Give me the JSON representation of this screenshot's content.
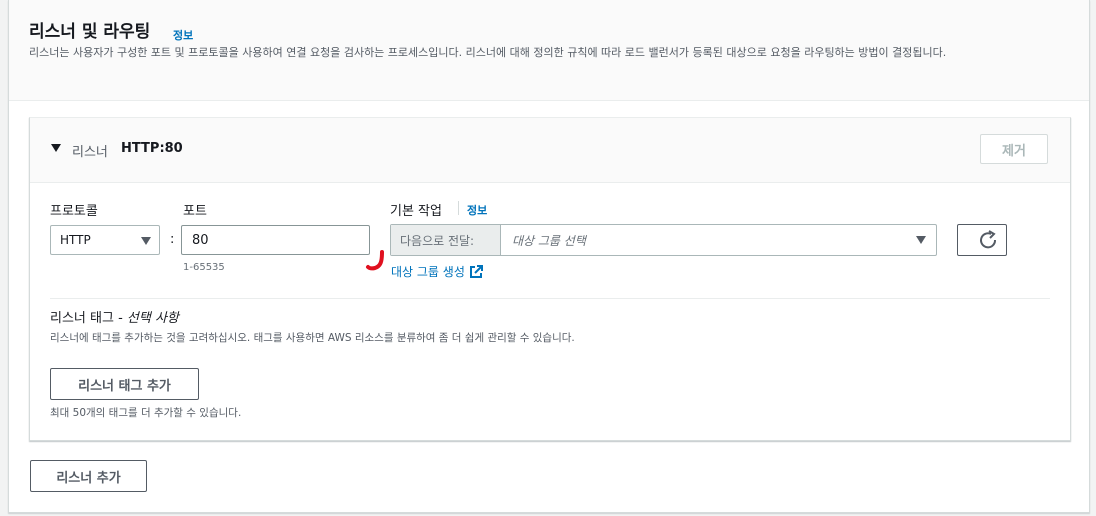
{
  "section": {
    "title": "리스너 및 라우팅",
    "info_link": "정보",
    "description": "리스너는 사용자가 구성한 포트 및 프로토콜을 사용하여 연결 요청을 검사하는 프로세스입니다. 리스너에 대해 정의한 규칙에 따라 로드 밸런서가 등록된 대상으로 요청을 라우팅하는 방법이 결정됩니다."
  },
  "listener": {
    "label": "리스너",
    "protocol_port": "HTTP:80",
    "remove_button": "제거",
    "protocol_label": "프로토콜",
    "protocol_value": "HTTP",
    "colon": ":",
    "port_label": "포트",
    "port_value": "80",
    "port_hint": "1-65535",
    "default_action_label": "기본 작업",
    "default_action_info": "정보",
    "forward_prefix": "다음으로 전달:",
    "target_group_placeholder": "대상 그룹 선택",
    "create_target_group_link": "대상 그룹 생성"
  },
  "tags": {
    "title_main": "리스너 태그 - ",
    "title_optional": "선택 사항",
    "description": "리스너에 태그를 추가하는 것을 고려하십시오. 태그를 사용하면 AWS 리소스를 분류하여 좀 더 쉽게 관리할 수 있습니다.",
    "add_button": "리스너 태그 추가",
    "limit_text": "최대 50개의 태그를 더 추가할 수 있습니다."
  },
  "footer": {
    "add_listener_button": "리스너 추가"
  },
  "colors": {
    "link": "#0073bb",
    "annotation_mark": "#e0101f"
  },
  "icons": {
    "expand": "caret-down-icon",
    "dropdown": "chevron-down-icon",
    "refresh": "refresh-icon",
    "external": "external-link-icon"
  }
}
